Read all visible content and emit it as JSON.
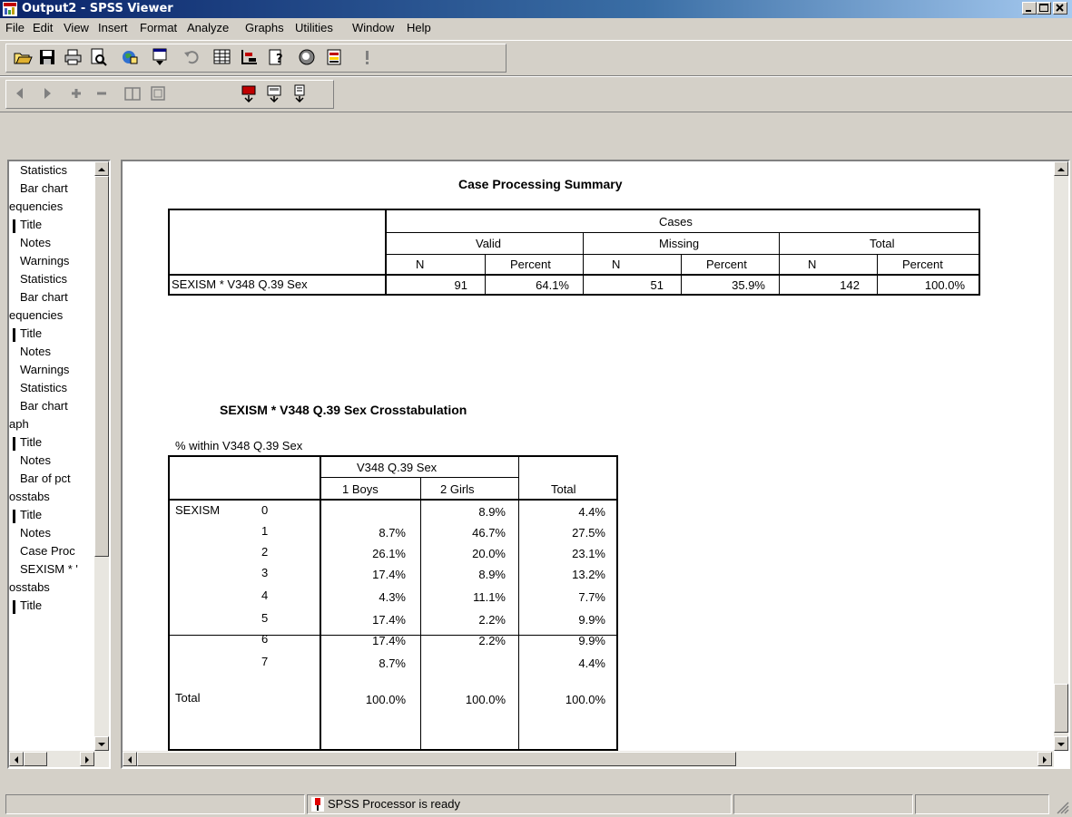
{
  "window": {
    "title": "Output2 - SPSS Viewer"
  },
  "menu": [
    "File",
    "Edit",
    "View",
    "Insert",
    "Format",
    "Analyze",
    "Graphs",
    "Utilities",
    "Window",
    "Help"
  ],
  "toolbar1_icons": [
    "open-icon",
    "save-icon",
    "print-icon",
    "print-preview-icon",
    "export-icon",
    "recall-dialog-icon",
    "undo-icon",
    "goto-data-icon",
    "variables-icon",
    "info-icon",
    "designate-window-icon",
    "select-last-output-icon",
    "run-icon"
  ],
  "toolbar2_icons": [
    "promote-icon",
    "demote-icon",
    "expand-icon",
    "collapse-icon",
    "show-icon",
    "hide-icon",
    "insert-heading-icon",
    "insert-title-icon",
    "insert-text-icon"
  ],
  "outline": {
    "items": [
      "Statistics",
      "Bar chart",
      "equencies",
      "Title",
      "Notes",
      "Warnings",
      "Statistics",
      "Bar chart",
      "equencies",
      "Title",
      "Notes",
      "Warnings",
      "Statistics",
      "Bar chart",
      "aph",
      "Title",
      "Notes",
      "Bar of pct",
      "osstabs",
      "Title",
      "Notes",
      "Case Proc",
      "SEXISM * '",
      "osstabs",
      "Title"
    ]
  },
  "case_summary": {
    "title": "Case Processing Summary",
    "cases_header": "Cases",
    "groups": [
      "Valid",
      "Missing",
      "Total"
    ],
    "subheaders": [
      "N",
      "Percent",
      "N",
      "Percent",
      "N",
      "Percent"
    ],
    "row_label": "SEXISM * V348  Q.39 Sex",
    "row_values": [
      "91",
      "64.1%",
      "51",
      "35.9%",
      "142",
      "100.0%"
    ]
  },
  "crosstab": {
    "title": "SEXISM * V348  Q.39 Sex Crosstabulation",
    "subtitle": "% within V348  Q.39 Sex",
    "col_group": "V348  Q.39 Sex",
    "columns": [
      "1  Boys",
      "2  Girls",
      "Total"
    ],
    "row_var": "SEXISM",
    "rows": [
      {
        "label": "0",
        "values": [
          "",
          "8.9%",
          "4.4%"
        ]
      },
      {
        "label": "1",
        "values": [
          "8.7%",
          "46.7%",
          "27.5%"
        ]
      },
      {
        "label": "2",
        "values": [
          "26.1%",
          "20.0%",
          "23.1%"
        ]
      },
      {
        "label": "3",
        "values": [
          "17.4%",
          "8.9%",
          "13.2%"
        ]
      },
      {
        "label": "4",
        "values": [
          "4.3%",
          "11.1%",
          "7.7%"
        ]
      },
      {
        "label": "5",
        "values": [
          "17.4%",
          "2.2%",
          "9.9%"
        ]
      },
      {
        "label": "6",
        "values": [
          "17.4%",
          "2.2%",
          "9.9%"
        ]
      },
      {
        "label": "7",
        "values": [
          "8.7%",
          "",
          "4.4%"
        ]
      }
    ],
    "total_label": "Total",
    "total_values": [
      "100.0%",
      "100.0%",
      "100.0%"
    ]
  },
  "status": {
    "message": "SPSS Processor  is ready"
  },
  "colors": {
    "titlebar_start": "#0a246a",
    "titlebar_end": "#a6caf0",
    "chrome": "#d4d0c8",
    "status_icon": "#e00000"
  }
}
